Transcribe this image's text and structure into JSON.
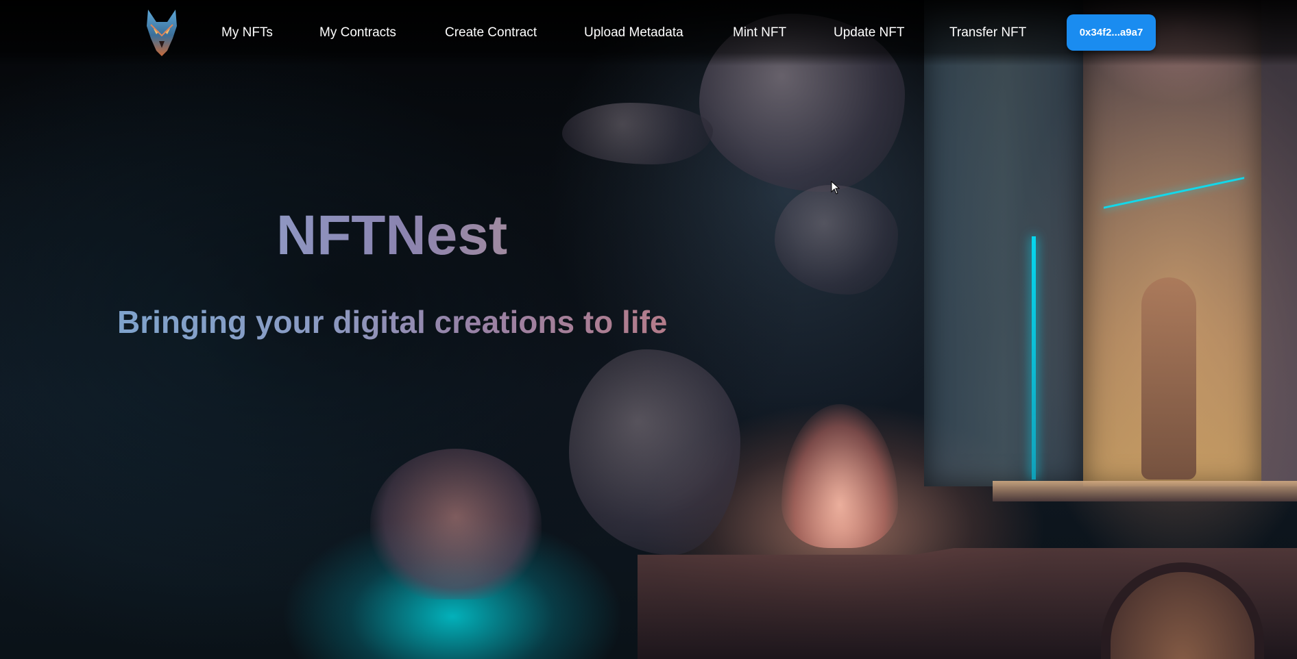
{
  "navbar": {
    "logo_alt": "wolf logo",
    "links": [
      {
        "label": "My NFTs"
      },
      {
        "label": "My Contracts"
      },
      {
        "label": "Create Contract"
      },
      {
        "label": "Upload Metadata"
      },
      {
        "label": "Mint NFT"
      },
      {
        "label": "Update NFT"
      },
      {
        "label": "Transfer NFT"
      }
    ],
    "wallet_address": "0x34f2...a9a7"
  },
  "hero": {
    "title": "NFTNest",
    "subtitle": "Bringing your digital creations to life"
  },
  "colors": {
    "wallet_button": "#1a8cf0",
    "nav_text": "#ffffff",
    "background": "#06080d"
  },
  "icons": {
    "logo": "wolf-icon",
    "cursor": "mouse-pointer-icon"
  }
}
